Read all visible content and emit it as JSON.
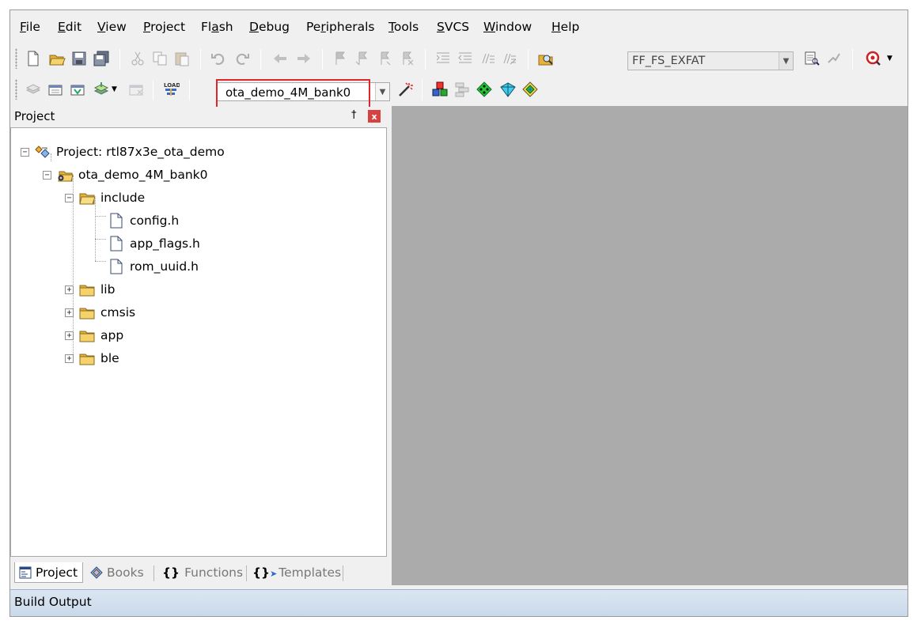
{
  "menu": [
    {
      "pre": "",
      "u": "F",
      "post": "ile"
    },
    {
      "pre": "",
      "u": "E",
      "post": "dit"
    },
    {
      "pre": "",
      "u": "V",
      "post": "iew"
    },
    {
      "pre": "",
      "u": "P",
      "post": "roject"
    },
    {
      "pre": "Fl",
      "u": "a",
      "post": "sh"
    },
    {
      "pre": "",
      "u": "D",
      "post": "ebug"
    },
    {
      "pre": "Pe",
      "u": "r",
      "post": "ipherals"
    },
    {
      "pre": "",
      "u": "T",
      "post": "ools"
    },
    {
      "pre": "",
      "u": "S",
      "post": "VCS"
    },
    {
      "pre": "",
      "u": "W",
      "post": "indow"
    },
    {
      "pre": "",
      "u": "H",
      "post": "elp"
    }
  ],
  "toolbar": {
    "find_combo_value": "FF_FS_EXFAT",
    "target_combo_value": "ota_demo_4M_bank0"
  },
  "icons": {
    "toolbar1": [
      "new-file-icon",
      "open-file-icon",
      "save-icon",
      "save-all-icon",
      "cut-icon",
      "copy-icon",
      "paste-icon",
      "undo-icon",
      "redo-icon",
      "navigate-back-icon",
      "navigate-forward-icon",
      "bookmark-icon",
      "prev-bookmark-icon",
      "next-bookmark-icon",
      "clear-bookmarks-icon",
      "indent-icon",
      "unindent-icon",
      "comment-icon",
      "uncomment-icon",
      "find-in-files-icon",
      "find-icon",
      "incremental-find-icon",
      "debug-session-icon"
    ],
    "toolbar2": [
      "translate-icon",
      "build-icon",
      "rebuild-icon",
      "batch-build-icon",
      "stop-build-icon",
      "download-icon",
      "options-for-target-icon",
      "manage-components-icon",
      "select-packs-icon",
      "pack-installer-icon",
      "manage-project-items-icon"
    ]
  },
  "project_panel": {
    "title": "Project",
    "pin_glyph": "†",
    "close_glyph": "x",
    "tree": {
      "project_label": "Project: rtl87x3e_ota_demo",
      "target_label": "ota_demo_4M_bank0",
      "include": {
        "label": "include",
        "files": [
          "config.h",
          "app_flags.h",
          "rom_uuid.h"
        ]
      },
      "groups": [
        "lib",
        "cmsis",
        "app",
        "ble"
      ]
    }
  },
  "tabs": [
    {
      "label": "Project",
      "active": true
    },
    {
      "label": "Books",
      "active": false
    },
    {
      "label": "Functions",
      "active": false
    },
    {
      "label": "Templates",
      "active": false
    }
  ],
  "build_output": {
    "title": "Build Output"
  },
  "colors": {
    "highlight": "#e0252c",
    "editor_background": "#ababab",
    "build_bar": "#c8d8ea"
  }
}
